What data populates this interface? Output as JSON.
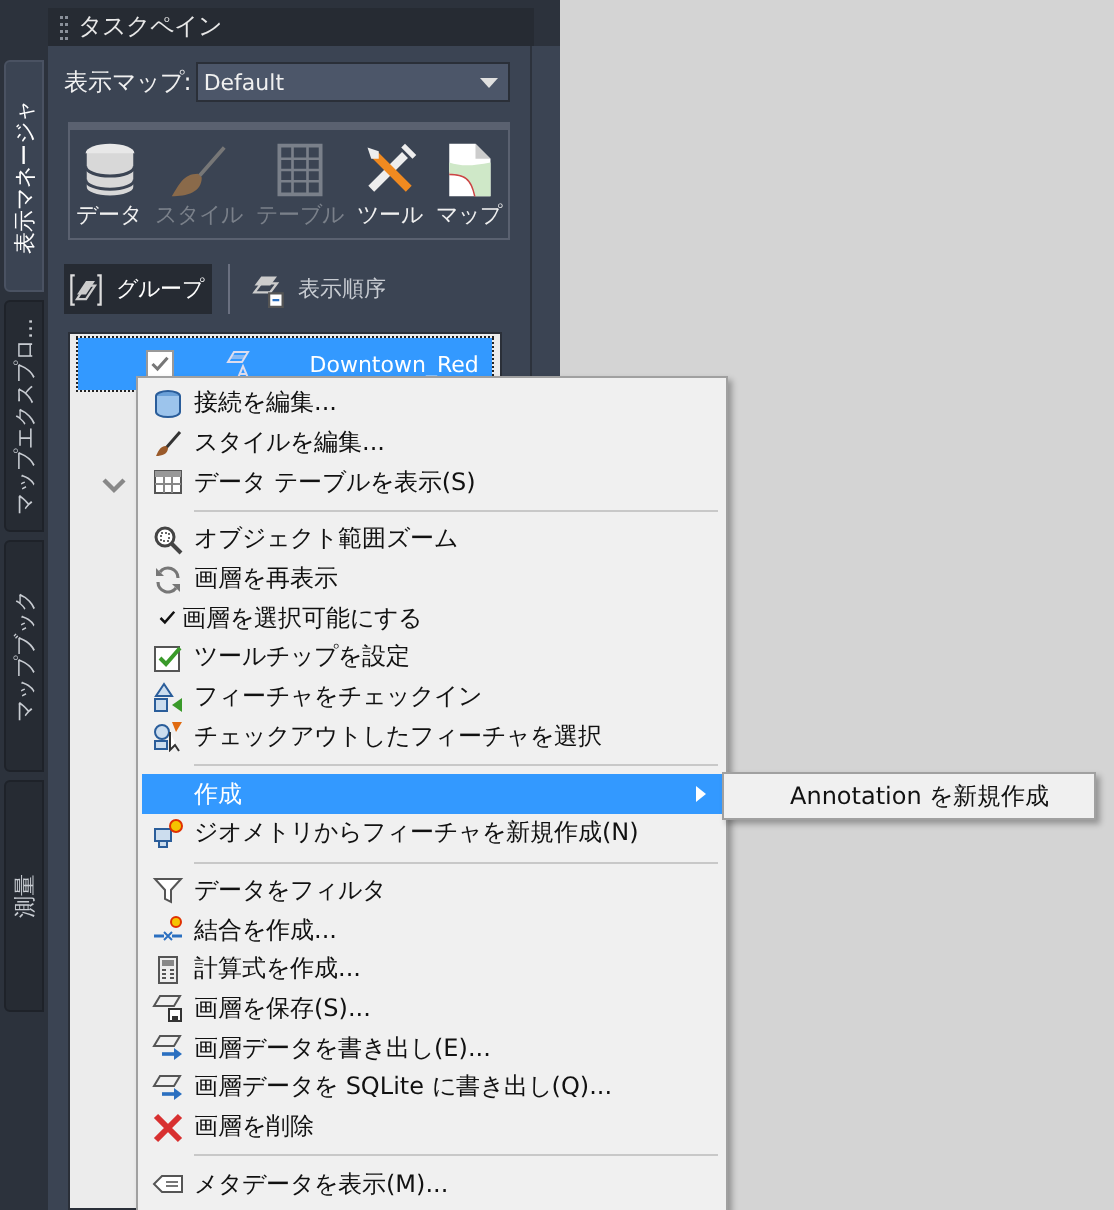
{
  "side_tabs": [
    {
      "label": "表示マネージャ",
      "selected": true
    },
    {
      "label": "マップエクスプロ...",
      "selected": false
    },
    {
      "label": "マップブック",
      "selected": false
    },
    {
      "label": "測量",
      "selected": false
    }
  ],
  "task_pane": {
    "title": "タスクペイン"
  },
  "map_selector": {
    "label": "表示マップ:",
    "value": "Default"
  },
  "toolbar": [
    {
      "label": "データ",
      "disabled": false
    },
    {
      "label": "スタイル",
      "disabled": true
    },
    {
      "label": "テーブル",
      "disabled": true
    },
    {
      "label": "ツール",
      "disabled": false
    },
    {
      "label": "マップ",
      "disabled": false
    }
  ],
  "view_tabs": [
    {
      "label": "グループ",
      "selected": true
    },
    {
      "label": "表示順序",
      "selected": false
    }
  ],
  "layers": [
    {
      "name": "Downtown_Red",
      "checked": true,
      "selected": true
    }
  ],
  "context_menu": {
    "items": [
      {
        "kind": "item",
        "label": "接続を編集...",
        "checked": false,
        "selected": false,
        "submenu": false
      },
      {
        "kind": "item",
        "label": "スタイルを編集...",
        "checked": false,
        "selected": false,
        "submenu": false
      },
      {
        "kind": "item",
        "label": "データ テーブルを表示(S)",
        "checked": false,
        "selected": false,
        "submenu": false
      },
      {
        "kind": "separator"
      },
      {
        "kind": "item",
        "label": "オブジェクト範囲ズーム",
        "checked": false,
        "selected": false,
        "submenu": false
      },
      {
        "kind": "item",
        "label": "画層を再表示",
        "checked": false,
        "selected": false,
        "submenu": false
      },
      {
        "kind": "item",
        "label": "画層を選択可能にする",
        "checked": true,
        "selected": false,
        "submenu": false
      },
      {
        "kind": "item",
        "label": "ツールチップを設定",
        "checked": false,
        "selected": false,
        "submenu": false
      },
      {
        "kind": "item",
        "label": "フィーチャをチェックイン",
        "checked": false,
        "selected": false,
        "submenu": false
      },
      {
        "kind": "item",
        "label": "チェックアウトしたフィーチャを選択",
        "checked": false,
        "selected": false,
        "submenu": false
      },
      {
        "kind": "separator"
      },
      {
        "kind": "item",
        "label": "作成",
        "checked": false,
        "selected": true,
        "submenu": true
      },
      {
        "kind": "item",
        "label": "ジオメトリからフィーチャを新規作成(N)",
        "checked": false,
        "selected": false,
        "submenu": false
      },
      {
        "kind": "separator"
      },
      {
        "kind": "item",
        "label": "データをフィルタ",
        "checked": false,
        "selected": false,
        "submenu": false
      },
      {
        "kind": "item",
        "label": "結合を作成...",
        "checked": false,
        "selected": false,
        "submenu": false
      },
      {
        "kind": "item",
        "label": "計算式を作成...",
        "checked": false,
        "selected": false,
        "submenu": false
      },
      {
        "kind": "item",
        "label": "画層を保存(S)...",
        "checked": false,
        "selected": false,
        "submenu": false
      },
      {
        "kind": "item",
        "label": "画層データを書き出し(E)...",
        "checked": false,
        "selected": false,
        "submenu": false
      },
      {
        "kind": "item",
        "label": "画層データを SQLite に書き出し(Q)...",
        "checked": false,
        "selected": false,
        "submenu": false
      },
      {
        "kind": "item",
        "label": "画層を削除",
        "checked": false,
        "selected": false,
        "submenu": false
      },
      {
        "kind": "separator"
      },
      {
        "kind": "item",
        "label": "メタデータを表示(M)...",
        "checked": false,
        "selected": false,
        "submenu": false
      }
    ]
  },
  "submenu": {
    "items": [
      {
        "label": "Annotation を新規作成"
      }
    ]
  }
}
